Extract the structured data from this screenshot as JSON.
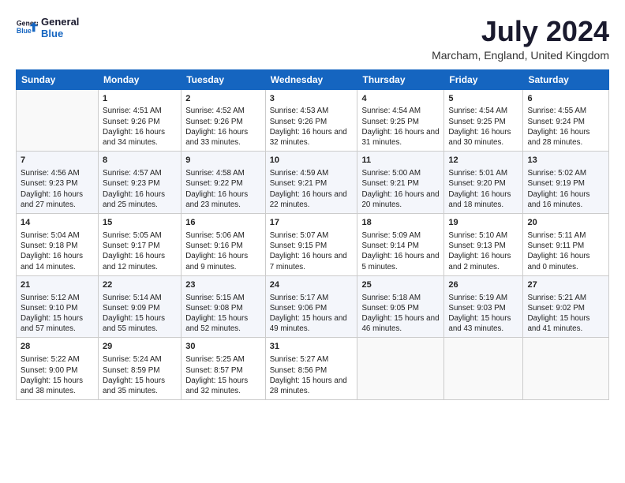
{
  "header": {
    "logo_general": "General",
    "logo_blue": "Blue",
    "month_title": "July 2024",
    "location": "Marcham, England, United Kingdom"
  },
  "days_of_week": [
    "Sunday",
    "Monday",
    "Tuesday",
    "Wednesday",
    "Thursday",
    "Friday",
    "Saturday"
  ],
  "weeks": [
    [
      {
        "day": "",
        "sunrise": "",
        "sunset": "",
        "daylight": ""
      },
      {
        "day": "1",
        "sunrise": "Sunrise: 4:51 AM",
        "sunset": "Sunset: 9:26 PM",
        "daylight": "Daylight: 16 hours and 34 minutes."
      },
      {
        "day": "2",
        "sunrise": "Sunrise: 4:52 AM",
        "sunset": "Sunset: 9:26 PM",
        "daylight": "Daylight: 16 hours and 33 minutes."
      },
      {
        "day": "3",
        "sunrise": "Sunrise: 4:53 AM",
        "sunset": "Sunset: 9:26 PM",
        "daylight": "Daylight: 16 hours and 32 minutes."
      },
      {
        "day": "4",
        "sunrise": "Sunrise: 4:54 AM",
        "sunset": "Sunset: 9:25 PM",
        "daylight": "Daylight: 16 hours and 31 minutes."
      },
      {
        "day": "5",
        "sunrise": "Sunrise: 4:54 AM",
        "sunset": "Sunset: 9:25 PM",
        "daylight": "Daylight: 16 hours and 30 minutes."
      },
      {
        "day": "6",
        "sunrise": "Sunrise: 4:55 AM",
        "sunset": "Sunset: 9:24 PM",
        "daylight": "Daylight: 16 hours and 28 minutes."
      }
    ],
    [
      {
        "day": "7",
        "sunrise": "Sunrise: 4:56 AM",
        "sunset": "Sunset: 9:23 PM",
        "daylight": "Daylight: 16 hours and 27 minutes."
      },
      {
        "day": "8",
        "sunrise": "Sunrise: 4:57 AM",
        "sunset": "Sunset: 9:23 PM",
        "daylight": "Daylight: 16 hours and 25 minutes."
      },
      {
        "day": "9",
        "sunrise": "Sunrise: 4:58 AM",
        "sunset": "Sunset: 9:22 PM",
        "daylight": "Daylight: 16 hours and 23 minutes."
      },
      {
        "day": "10",
        "sunrise": "Sunrise: 4:59 AM",
        "sunset": "Sunset: 9:21 PM",
        "daylight": "Daylight: 16 hours and 22 minutes."
      },
      {
        "day": "11",
        "sunrise": "Sunrise: 5:00 AM",
        "sunset": "Sunset: 9:21 PM",
        "daylight": "Daylight: 16 hours and 20 minutes."
      },
      {
        "day": "12",
        "sunrise": "Sunrise: 5:01 AM",
        "sunset": "Sunset: 9:20 PM",
        "daylight": "Daylight: 16 hours and 18 minutes."
      },
      {
        "day": "13",
        "sunrise": "Sunrise: 5:02 AM",
        "sunset": "Sunset: 9:19 PM",
        "daylight": "Daylight: 16 hours and 16 minutes."
      }
    ],
    [
      {
        "day": "14",
        "sunrise": "Sunrise: 5:04 AM",
        "sunset": "Sunset: 9:18 PM",
        "daylight": "Daylight: 16 hours and 14 minutes."
      },
      {
        "day": "15",
        "sunrise": "Sunrise: 5:05 AM",
        "sunset": "Sunset: 9:17 PM",
        "daylight": "Daylight: 16 hours and 12 minutes."
      },
      {
        "day": "16",
        "sunrise": "Sunrise: 5:06 AM",
        "sunset": "Sunset: 9:16 PM",
        "daylight": "Daylight: 16 hours and 9 minutes."
      },
      {
        "day": "17",
        "sunrise": "Sunrise: 5:07 AM",
        "sunset": "Sunset: 9:15 PM",
        "daylight": "Daylight: 16 hours and 7 minutes."
      },
      {
        "day": "18",
        "sunrise": "Sunrise: 5:09 AM",
        "sunset": "Sunset: 9:14 PM",
        "daylight": "Daylight: 16 hours and 5 minutes."
      },
      {
        "day": "19",
        "sunrise": "Sunrise: 5:10 AM",
        "sunset": "Sunset: 9:13 PM",
        "daylight": "Daylight: 16 hours and 2 minutes."
      },
      {
        "day": "20",
        "sunrise": "Sunrise: 5:11 AM",
        "sunset": "Sunset: 9:11 PM",
        "daylight": "Daylight: 16 hours and 0 minutes."
      }
    ],
    [
      {
        "day": "21",
        "sunrise": "Sunrise: 5:12 AM",
        "sunset": "Sunset: 9:10 PM",
        "daylight": "Daylight: 15 hours and 57 minutes."
      },
      {
        "day": "22",
        "sunrise": "Sunrise: 5:14 AM",
        "sunset": "Sunset: 9:09 PM",
        "daylight": "Daylight: 15 hours and 55 minutes."
      },
      {
        "day": "23",
        "sunrise": "Sunrise: 5:15 AM",
        "sunset": "Sunset: 9:08 PM",
        "daylight": "Daylight: 15 hours and 52 minutes."
      },
      {
        "day": "24",
        "sunrise": "Sunrise: 5:17 AM",
        "sunset": "Sunset: 9:06 PM",
        "daylight": "Daylight: 15 hours and 49 minutes."
      },
      {
        "day": "25",
        "sunrise": "Sunrise: 5:18 AM",
        "sunset": "Sunset: 9:05 PM",
        "daylight": "Daylight: 15 hours and 46 minutes."
      },
      {
        "day": "26",
        "sunrise": "Sunrise: 5:19 AM",
        "sunset": "Sunset: 9:03 PM",
        "daylight": "Daylight: 15 hours and 43 minutes."
      },
      {
        "day": "27",
        "sunrise": "Sunrise: 5:21 AM",
        "sunset": "Sunset: 9:02 PM",
        "daylight": "Daylight: 15 hours and 41 minutes."
      }
    ],
    [
      {
        "day": "28",
        "sunrise": "Sunrise: 5:22 AM",
        "sunset": "Sunset: 9:00 PM",
        "daylight": "Daylight: 15 hours and 38 minutes."
      },
      {
        "day": "29",
        "sunrise": "Sunrise: 5:24 AM",
        "sunset": "Sunset: 8:59 PM",
        "daylight": "Daylight: 15 hours and 35 minutes."
      },
      {
        "day": "30",
        "sunrise": "Sunrise: 5:25 AM",
        "sunset": "Sunset: 8:57 PM",
        "daylight": "Daylight: 15 hours and 32 minutes."
      },
      {
        "day": "31",
        "sunrise": "Sunrise: 5:27 AM",
        "sunset": "Sunset: 8:56 PM",
        "daylight": "Daylight: 15 hours and 28 minutes."
      },
      {
        "day": "",
        "sunrise": "",
        "sunset": "",
        "daylight": ""
      },
      {
        "day": "",
        "sunrise": "",
        "sunset": "",
        "daylight": ""
      },
      {
        "day": "",
        "sunrise": "",
        "sunset": "",
        "daylight": ""
      }
    ]
  ]
}
